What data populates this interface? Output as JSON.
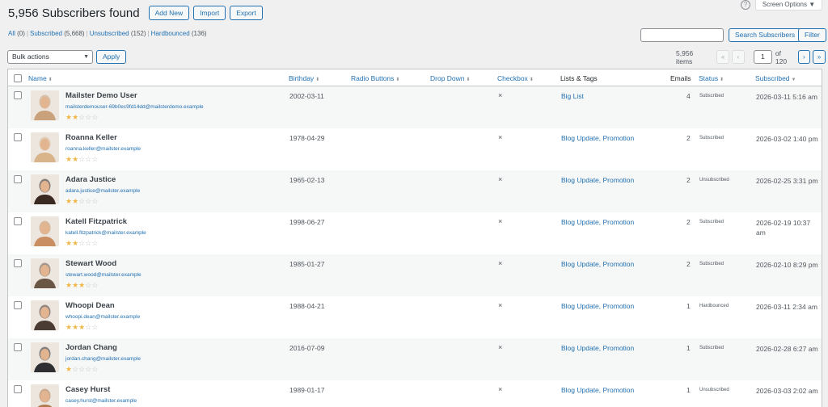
{
  "header": {
    "title": "5,956 Subscribers found",
    "add_new": "Add New",
    "import": "Import",
    "export": "Export",
    "help_glyph": "?",
    "screen_options": "Screen Options ▼"
  },
  "views": [
    {
      "label": "All",
      "count": "(0)"
    },
    {
      "label": "Subscribed",
      "count": "(5,668)"
    },
    {
      "label": "Unsubscribed",
      "count": "(152)"
    },
    {
      "label": "Hardbounced",
      "count": "(136)"
    }
  ],
  "search": {
    "button": "Search Subscribers",
    "filter": "Filter",
    "value": ""
  },
  "bulk": {
    "selected": "Bulk actions",
    "apply": "Apply"
  },
  "pagination": {
    "items": "5,956 items",
    "first": "«",
    "prev": "‹",
    "current": "1",
    "of": "of 120",
    "next": "›",
    "last": "»"
  },
  "columns": {
    "name": "Name",
    "birthday": "Birthday",
    "radio": "Radio Buttons",
    "dropdown": "Drop Down",
    "checkbox": "Checkbox",
    "lists": "Lists & Tags",
    "emails": "Emails",
    "status": "Status",
    "subscribed": "Subscribed",
    "sort_glyph": "⬍",
    "sort_desc_glyph": "▼"
  },
  "rows": [
    {
      "name": "Mailster Demo User",
      "email": "mailsterdemouser-69b0ec9fd14dd@mailsterdemo.example",
      "rating": 2,
      "birthday": "2002-03-11",
      "checkbox": "×",
      "lists": "Big List",
      "emails": "4",
      "status": "Subscribed",
      "subscribed": "2026-03-11 5:16 am",
      "avatar_color": "#c9a17a"
    },
    {
      "name": "Roanna Keller",
      "email": "roanna.keller@mailster.example",
      "rating": 2,
      "birthday": "1978-04-29",
      "checkbox": "×",
      "lists": "Blog Update, Promotion",
      "emails": "2",
      "status": "Subscribed",
      "subscribed": "2026-03-02 1:40 pm",
      "avatar_color": "#d9b48a"
    },
    {
      "name": "Adara Justice",
      "email": "adara.justice@mailster.example",
      "rating": 2,
      "birthday": "1965-02-13",
      "checkbox": "×",
      "lists": "Blog Update, Promotion",
      "emails": "2",
      "status": "Unsubscribed",
      "subscribed": "2026-02-25 3:31 pm",
      "avatar_color": "#3a2a22"
    },
    {
      "name": "Katell Fitzpatrick",
      "email": "katell.fitzpatrick@mailster.example",
      "rating": 2,
      "birthday": "1998-06-27",
      "checkbox": "×",
      "lists": "Blog Update, Promotion",
      "emails": "2",
      "status": "Subscribed",
      "subscribed": "2026-02-19 10:37 am",
      "avatar_color": "#c98f63"
    },
    {
      "name": "Stewart Wood",
      "email": "stewart.wood@mailster.example",
      "rating": 3,
      "birthday": "1985-01-27",
      "checkbox": "×",
      "lists": "Blog Update, Promotion",
      "emails": "2",
      "status": "Subscribed",
      "subscribed": "2026-02-10 8:29 pm",
      "avatar_color": "#6b5646"
    },
    {
      "name": "Whoopi Dean",
      "email": "whoopi.dean@mailster.example",
      "rating": 3,
      "birthday": "1988-04-21",
      "checkbox": "×",
      "lists": "Blog Update, Promotion",
      "emails": "1",
      "status": "Hardbounced",
      "subscribed": "2026-03-11 2:34 am",
      "avatar_color": "#4a3b33"
    },
    {
      "name": "Jordan Chang",
      "email": "jordan.chang@mailster.example",
      "rating": 1,
      "birthday": "2016-07-09",
      "checkbox": "×",
      "lists": "Blog Update, Promotion",
      "emails": "1",
      "status": "Subscribed",
      "subscribed": "2026-02-28 6:27 am",
      "avatar_color": "#2f2f33"
    },
    {
      "name": "Casey Hurst",
      "email": "casey.hurst@mailster.example",
      "rating": 0,
      "birthday": "1989-01-17",
      "checkbox": "×",
      "lists": "Blog Update, Promotion",
      "emails": "1",
      "status": "Unsubscribed",
      "subscribed": "2026-03-03 2:02 am",
      "avatar_color": "#b07a4e"
    }
  ],
  "star_glyph_on": "★",
  "star_glyph_off": "☆"
}
